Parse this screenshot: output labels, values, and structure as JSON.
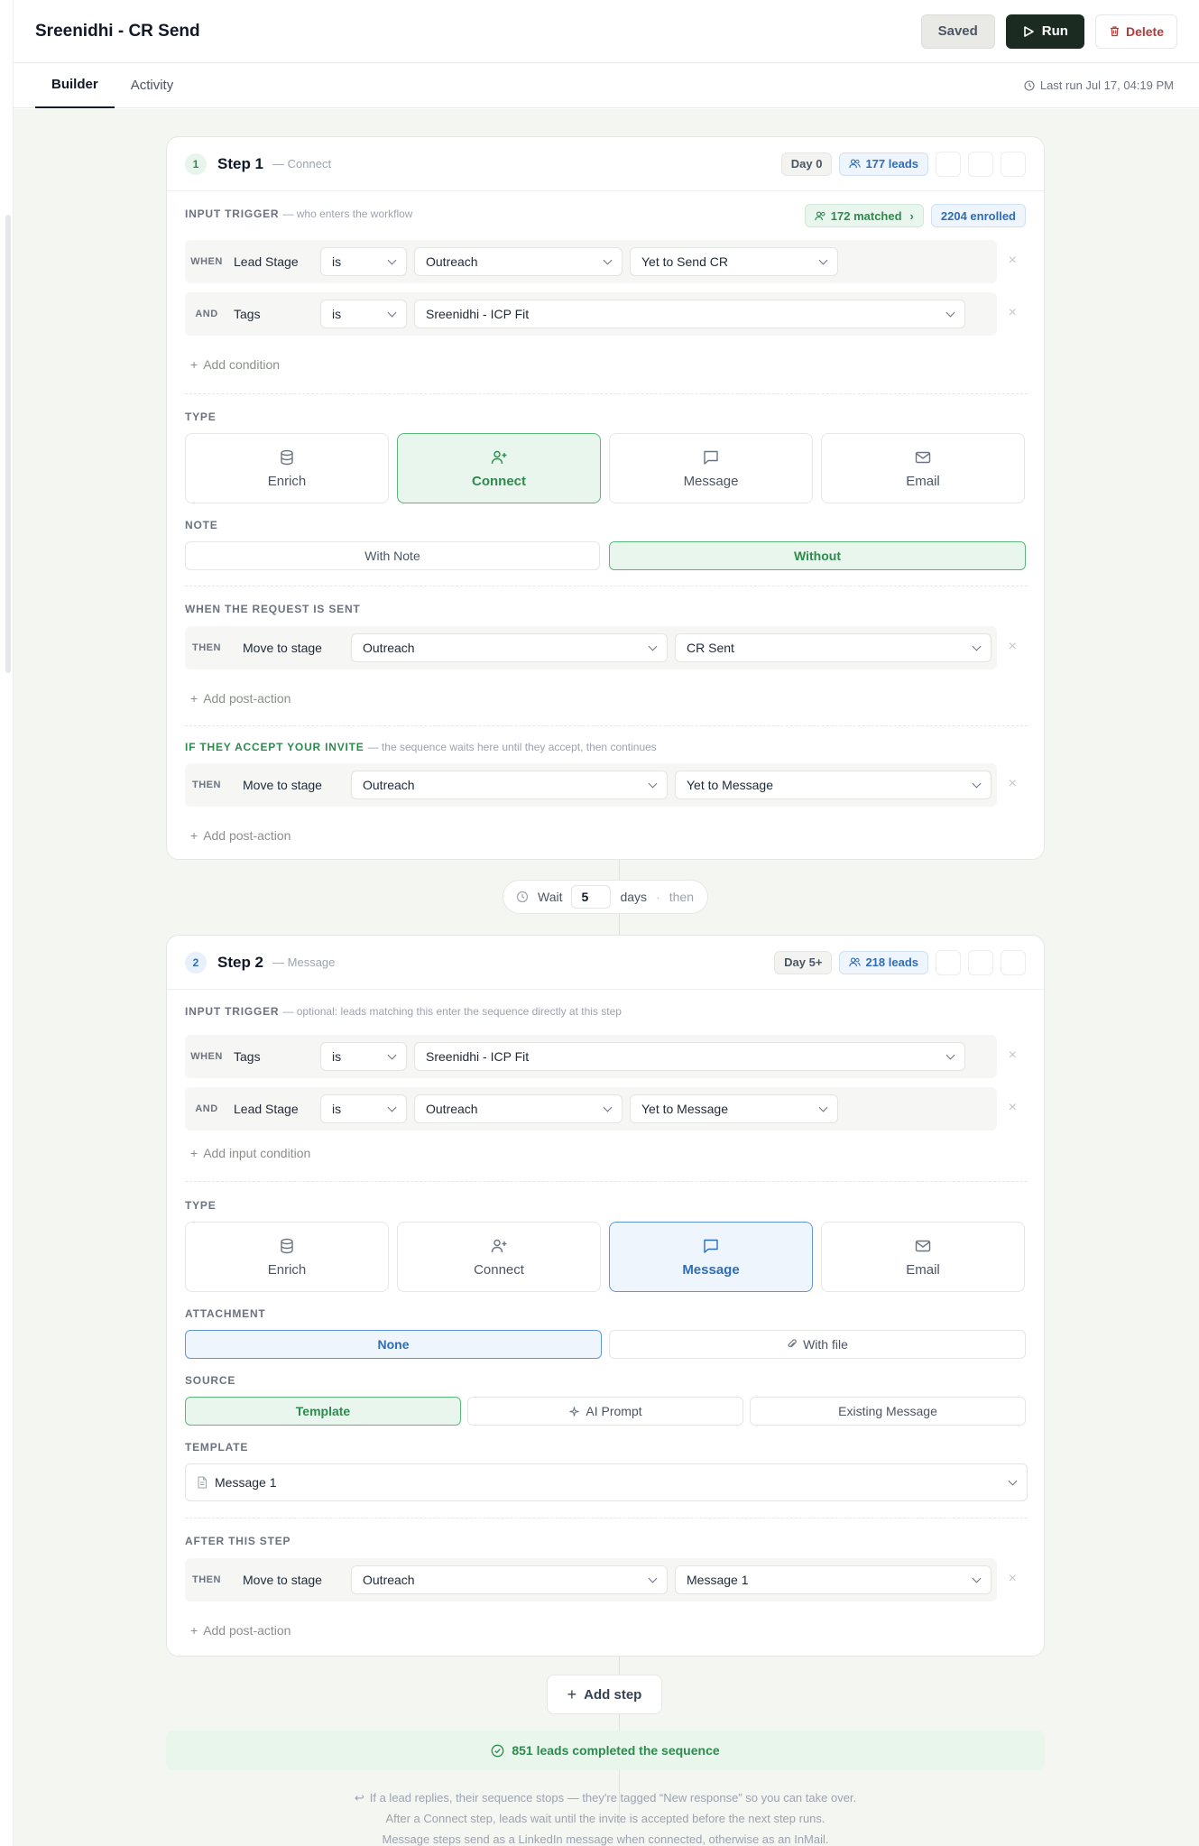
{
  "header": {
    "title": "Sreenidhi - CR Send",
    "saved_label": "Saved",
    "run_label": "Run",
    "delete_label": "Delete"
  },
  "tabs": [
    {
      "label": "Builder",
      "active": true
    },
    {
      "label": "Activity",
      "active": false
    }
  ],
  "last_run": "Last run Jul 17, 04:19 PM",
  "step1": {
    "num": "1",
    "title": "Step 1",
    "subtitle": "— Connect",
    "day": "Day 0",
    "leads": "177 leads",
    "input_trigger_label": "INPUT TRIGGER",
    "input_trigger_hint": "— who enters the workflow",
    "matched": "172 matched",
    "enrolled": "2204 enrolled",
    "conditions": [
      {
        "kw": "WHEN",
        "field": "Lead Stage",
        "op": "is",
        "v1": "Outreach",
        "v2": "Yet to Send CR"
      },
      {
        "kw": "AND",
        "field": "Tags",
        "op": "is",
        "v1": "Sreenidhi - ICP Fit"
      }
    ],
    "add_condition": "Add condition",
    "type_label": "TYPE",
    "types": [
      "Enrich",
      "Connect",
      "Message",
      "Email"
    ],
    "note_label": "NOTE",
    "note_options": [
      "With Note",
      "Without"
    ],
    "sent_label": "WHEN THE REQUEST IS SENT",
    "sent_action": {
      "kw": "THEN",
      "action": "Move to stage",
      "v1": "Outreach",
      "v2": "CR Sent"
    },
    "add_post_action": "Add post-action",
    "accept_label": "IF THEY ACCEPT YOUR INVITE",
    "accept_hint": "— the sequence waits here until they accept, then continues",
    "accept_action": {
      "kw": "THEN",
      "action": "Move to stage",
      "v1": "Outreach",
      "v2": "Yet to Message"
    },
    "add_post_action_2": "Add post-action"
  },
  "wait": {
    "label": "Wait",
    "value": "5",
    "unit": "days",
    "sep": "·",
    "then": "then"
  },
  "step2": {
    "num": "2",
    "title": "Step 2",
    "subtitle": "— Message",
    "day": "Day 5+",
    "leads": "218 leads",
    "input_trigger_label": "INPUT TRIGGER",
    "input_trigger_hint": "— optional: leads matching this enter the sequence directly at this step",
    "conditions": [
      {
        "kw": "WHEN",
        "field": "Tags",
        "op": "is",
        "v1": "Sreenidhi - ICP Fit"
      },
      {
        "kw": "AND",
        "field": "Lead Stage",
        "op": "is",
        "v1": "Outreach",
        "v2": "Yet to Message"
      }
    ],
    "add_condition": "Add input condition",
    "type_label": "TYPE",
    "types": [
      "Enrich",
      "Connect",
      "Message",
      "Email"
    ],
    "attachment_label": "ATTACHMENT",
    "attachment_options": [
      "None",
      "With file"
    ],
    "source_label": "SOURCE",
    "source_options": [
      "Template",
      "AI Prompt",
      "Existing Message"
    ],
    "template_label": "TEMPLATE",
    "template_value": "Message 1",
    "after_label": "AFTER THIS STEP",
    "after_action": {
      "kw": "THEN",
      "action": "Move to stage",
      "v1": "Outreach",
      "v2": "Message 1"
    },
    "add_post_action": "Add post-action"
  },
  "add_step": "Add step",
  "completed": "851 leads completed the sequence",
  "footnotes": [
    "If a lead replies, their sequence stops — they're tagged “New response” so you can take over.",
    "After a Connect step, leads wait until the invite is accepted before the next step runs.",
    "Message steps send as a LinkedIn message when connected, otherwise as an InMail."
  ],
  "colors": {
    "green": "#2f8a4f",
    "blue": "#2f6db5",
    "run_bg": "#1b2b22",
    "delete": "#b23a3a",
    "canvas": "#f4f6f2"
  }
}
